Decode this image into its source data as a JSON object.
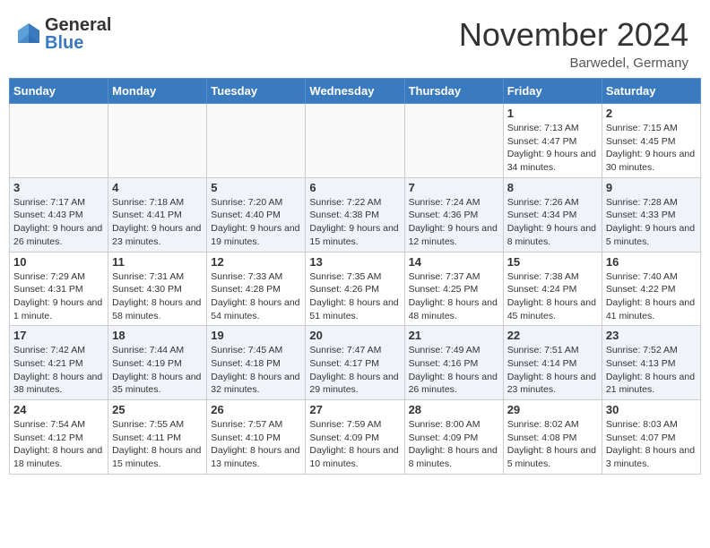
{
  "header": {
    "logo_general": "General",
    "logo_blue": "Blue",
    "month_title": "November 2024",
    "location": "Barwedel, Germany"
  },
  "days_of_week": [
    "Sunday",
    "Monday",
    "Tuesday",
    "Wednesday",
    "Thursday",
    "Friday",
    "Saturday"
  ],
  "weeks": [
    {
      "days": [
        {
          "num": "",
          "info": ""
        },
        {
          "num": "",
          "info": ""
        },
        {
          "num": "",
          "info": ""
        },
        {
          "num": "",
          "info": ""
        },
        {
          "num": "",
          "info": ""
        },
        {
          "num": "1",
          "info": "Sunrise: 7:13 AM\nSunset: 4:47 PM\nDaylight: 9 hours and 34 minutes."
        },
        {
          "num": "2",
          "info": "Sunrise: 7:15 AM\nSunset: 4:45 PM\nDaylight: 9 hours and 30 minutes."
        }
      ]
    },
    {
      "days": [
        {
          "num": "3",
          "info": "Sunrise: 7:17 AM\nSunset: 4:43 PM\nDaylight: 9 hours and 26 minutes."
        },
        {
          "num": "4",
          "info": "Sunrise: 7:18 AM\nSunset: 4:41 PM\nDaylight: 9 hours and 23 minutes."
        },
        {
          "num": "5",
          "info": "Sunrise: 7:20 AM\nSunset: 4:40 PM\nDaylight: 9 hours and 19 minutes."
        },
        {
          "num": "6",
          "info": "Sunrise: 7:22 AM\nSunset: 4:38 PM\nDaylight: 9 hours and 15 minutes."
        },
        {
          "num": "7",
          "info": "Sunrise: 7:24 AM\nSunset: 4:36 PM\nDaylight: 9 hours and 12 minutes."
        },
        {
          "num": "8",
          "info": "Sunrise: 7:26 AM\nSunset: 4:34 PM\nDaylight: 9 hours and 8 minutes."
        },
        {
          "num": "9",
          "info": "Sunrise: 7:28 AM\nSunset: 4:33 PM\nDaylight: 9 hours and 5 minutes."
        }
      ]
    },
    {
      "days": [
        {
          "num": "10",
          "info": "Sunrise: 7:29 AM\nSunset: 4:31 PM\nDaylight: 9 hours and 1 minute."
        },
        {
          "num": "11",
          "info": "Sunrise: 7:31 AM\nSunset: 4:30 PM\nDaylight: 8 hours and 58 minutes."
        },
        {
          "num": "12",
          "info": "Sunrise: 7:33 AM\nSunset: 4:28 PM\nDaylight: 8 hours and 54 minutes."
        },
        {
          "num": "13",
          "info": "Sunrise: 7:35 AM\nSunset: 4:26 PM\nDaylight: 8 hours and 51 minutes."
        },
        {
          "num": "14",
          "info": "Sunrise: 7:37 AM\nSunset: 4:25 PM\nDaylight: 8 hours and 48 minutes."
        },
        {
          "num": "15",
          "info": "Sunrise: 7:38 AM\nSunset: 4:24 PM\nDaylight: 8 hours and 45 minutes."
        },
        {
          "num": "16",
          "info": "Sunrise: 7:40 AM\nSunset: 4:22 PM\nDaylight: 8 hours and 41 minutes."
        }
      ]
    },
    {
      "days": [
        {
          "num": "17",
          "info": "Sunrise: 7:42 AM\nSunset: 4:21 PM\nDaylight: 8 hours and 38 minutes."
        },
        {
          "num": "18",
          "info": "Sunrise: 7:44 AM\nSunset: 4:19 PM\nDaylight: 8 hours and 35 minutes."
        },
        {
          "num": "19",
          "info": "Sunrise: 7:45 AM\nSunset: 4:18 PM\nDaylight: 8 hours and 32 minutes."
        },
        {
          "num": "20",
          "info": "Sunrise: 7:47 AM\nSunset: 4:17 PM\nDaylight: 8 hours and 29 minutes."
        },
        {
          "num": "21",
          "info": "Sunrise: 7:49 AM\nSunset: 4:16 PM\nDaylight: 8 hours and 26 minutes."
        },
        {
          "num": "22",
          "info": "Sunrise: 7:51 AM\nSunset: 4:14 PM\nDaylight: 8 hours and 23 minutes."
        },
        {
          "num": "23",
          "info": "Sunrise: 7:52 AM\nSunset: 4:13 PM\nDaylight: 8 hours and 21 minutes."
        }
      ]
    },
    {
      "days": [
        {
          "num": "24",
          "info": "Sunrise: 7:54 AM\nSunset: 4:12 PM\nDaylight: 8 hours and 18 minutes."
        },
        {
          "num": "25",
          "info": "Sunrise: 7:55 AM\nSunset: 4:11 PM\nDaylight: 8 hours and 15 minutes."
        },
        {
          "num": "26",
          "info": "Sunrise: 7:57 AM\nSunset: 4:10 PM\nDaylight: 8 hours and 13 minutes."
        },
        {
          "num": "27",
          "info": "Sunrise: 7:59 AM\nSunset: 4:09 PM\nDaylight: 8 hours and 10 minutes."
        },
        {
          "num": "28",
          "info": "Sunrise: 8:00 AM\nSunset: 4:09 PM\nDaylight: 8 hours and 8 minutes."
        },
        {
          "num": "29",
          "info": "Sunrise: 8:02 AM\nSunset: 4:08 PM\nDaylight: 8 hours and 5 minutes."
        },
        {
          "num": "30",
          "info": "Sunrise: 8:03 AM\nSunset: 4:07 PM\nDaylight: 8 hours and 3 minutes."
        }
      ]
    }
  ]
}
